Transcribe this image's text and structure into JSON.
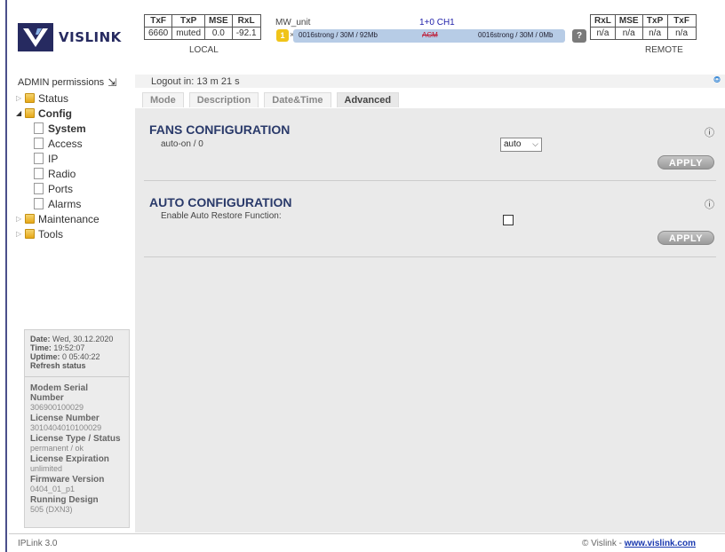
{
  "brand": {
    "name": "VISLINK"
  },
  "local": {
    "headers": [
      "TxF",
      "TxP",
      "MSE",
      "RxL"
    ],
    "values": [
      "6660",
      "muted",
      "0.0",
      "-92.1"
    ],
    "caption": "LOCAL"
  },
  "remote": {
    "headers": [
      "RxL",
      "MSE",
      "TxP",
      "TxF"
    ],
    "values": [
      "n/a",
      "n/a",
      "n/a",
      "n/a"
    ],
    "caption": "REMOTE"
  },
  "link": {
    "unit_name": "MW_unit",
    "channel": "1+0 CH1",
    "badge": "1",
    "times": "×",
    "left_profile": "0016strong / 30M / 92Mb",
    "mode": "ACM",
    "right_profile": "0016strong / 30M / 0Mb",
    "help": "?"
  },
  "sidebar": {
    "permissions": "ADMIN permissions",
    "tree": [
      {
        "label": "Status",
        "type": "folder"
      },
      {
        "label": "Config",
        "type": "folder"
      },
      {
        "label": "System",
        "type": "file"
      },
      {
        "label": "Access",
        "type": "file"
      },
      {
        "label": "IP",
        "type": "file"
      },
      {
        "label": "Radio",
        "type": "file"
      },
      {
        "label": "Ports",
        "type": "file"
      },
      {
        "label": "Alarms",
        "type": "file"
      },
      {
        "label": "Maintenance",
        "type": "folder"
      },
      {
        "label": "Tools",
        "type": "folder"
      }
    ],
    "status": {
      "date_label": "Date:",
      "date": "Wed, 30.12.2020",
      "time_label": "Time:",
      "time": "19:52:07",
      "uptime_label": "Uptime:",
      "uptime": "0 05:40:22",
      "refresh": "Refresh status"
    },
    "info": [
      {
        "label": "Modem Serial Number",
        "value": "306900100029"
      },
      {
        "label": "License Number",
        "value": "3010404010100029"
      },
      {
        "label": "License Type / Status",
        "value": "permanent / ok"
      },
      {
        "label": "License Expiration",
        "value": "unlimited"
      },
      {
        "label": "Firmware Version",
        "value": "0404_01_p1"
      },
      {
        "label": "Running Design",
        "value": "505 (DXN3)"
      }
    ]
  },
  "main": {
    "logout": "Logout in: 13 m 21 s",
    "tabs": [
      "Mode",
      "Description",
      "Date&Time",
      "Advanced"
    ],
    "fans": {
      "title": "FANS CONFIGURATION",
      "field": "auto-on / 0",
      "selected": "auto",
      "apply": "APPLY"
    },
    "auto": {
      "title": "AUTO CONFIGURATION",
      "field": "Enable Auto Restore Function:",
      "checked": false,
      "apply": "APPLY"
    }
  },
  "footer": {
    "version": "IPLink 3.0",
    "copyright": "© Vislink - ",
    "link": "www.vislink.com"
  }
}
